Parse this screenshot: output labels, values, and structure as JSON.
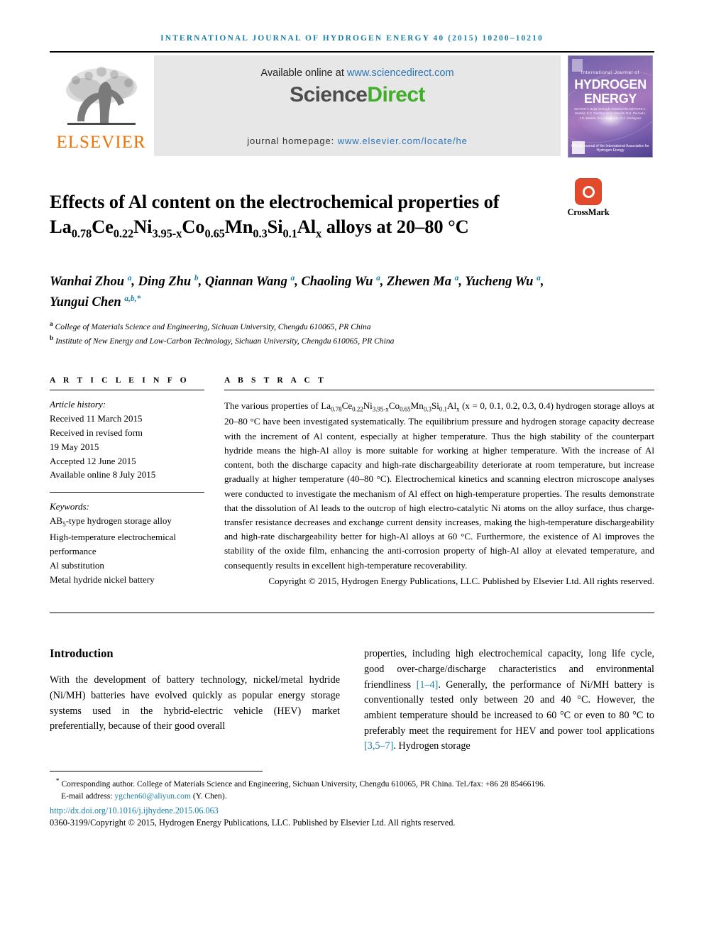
{
  "running_head": "INTERNATIONAL JOURNAL OF HYDROGEN ENERGY 40 (2015) 10200–10210",
  "masthead": {
    "publisher_logo_text": "ELSEVIER",
    "available_online_prefix": "Available online at ",
    "sciencedirect_url": "www.sciencedirect.com",
    "sciencedirect_logo_part1": "Science",
    "sciencedirect_logo_part2": "Direct",
    "journal_homepage_label": "journal homepage: ",
    "journal_homepage_url": "www.elsevier.com/locate/he",
    "cover": {
      "pre_title": "International Journal of",
      "line1": "HYDROGEN",
      "line2": "ENERGY",
      "editors": "EDITOR  T. Nejat Veziroglu\nASSOCIATE EDITORS  A. Bastida, E.C. Gardner, M.W. Moreda,\nB.D. Preciado, J.R. Bartlett, G.-L. Hu, F. Lee, C.C. Rodrigues",
      "footer": "Official Journal of the International Association for Hydrogen Energy"
    }
  },
  "article": {
    "title_segments": [
      {
        "t": "Effects of Al content on the electrochemical "
      },
      {
        "t": "properties of La"
      },
      {
        "sub": "0.78"
      },
      {
        "t": "Ce"
      },
      {
        "sub": "0.22"
      },
      {
        "t": "Ni"
      },
      {
        "sub": "3.95-x"
      },
      {
        "t": "Co"
      },
      {
        "sub": "0.65"
      },
      {
        "t": "Mn"
      },
      {
        "sub": "0.3"
      },
      {
        "t": "Si"
      },
      {
        "sub": "0.1"
      },
      {
        "t": "Al"
      },
      {
        "sub": "x"
      },
      {
        "t": " alloys at 20–80 °C"
      }
    ],
    "title_plain": "Effects of Al content on the electrochemical properties of La0.78Ce0.22Ni3.95-xCo0.65Mn0.3Si0.1Alx alloys at 20–80 °C",
    "crossmark_label": "CrossMark",
    "authors": "Wanhai Zhou a, Ding Zhu b, Qiannan Wang a, Chaoling Wu a, Zhewen Ma a, Yucheng Wu a, Yungui Chen a,b,*",
    "affiliations": [
      {
        "mark": "a",
        "text": "College of Materials Science and Engineering, Sichuan University, Chengdu 610065, PR China"
      },
      {
        "mark": "b",
        "text": "Institute of New Energy and Low-Carbon Technology, Sichuan University, Chengdu 610065, PR China"
      }
    ]
  },
  "article_info": {
    "heading": "A R T I C L E   I N F O",
    "history_label": "Article history:",
    "history": [
      "Received 11 March 2015",
      "Received in revised form",
      "19 May 2015",
      "Accepted 12 June 2015",
      "Available online 8 July 2015"
    ],
    "keywords_label": "Keywords:",
    "keywords": [
      "AB5-type hydrogen storage alloy",
      "High-temperature electrochemical performance",
      "Al substitution",
      "Metal hydride nickel battery"
    ]
  },
  "abstract": {
    "heading": "A B S T R A C T",
    "text": "The various properties of La0.78Ce0.22Ni3.95-xCo0.65Mn0.3Si0.1Alx (x = 0, 0.1, 0.2, 0.3, 0.4) hydrogen storage alloys at 20–80 °C have been investigated systematically. The equilibrium pressure and hydrogen storage capacity decrease with the increment of Al content, especially at higher temperature. Thus the high stability of the counterpart hydride means the high-Al alloy is more suitable for working at higher temperature. With the increase of Al content, both the discharge capacity and high-rate dischargeability deteriorate at room temperature, but increase gradually at higher temperature (40–80 °C). Electrochemical kinetics and scanning electron microscope analyses were conducted to investigate the mechanism of Al effect on high-temperature properties. The results demonstrate that the dissolution of Al leads to the outcrop of high electro-catalytic Ni atoms on the alloy surface, thus charge-transfer resistance decreases and exchange current density increases, making the high-temperature dischargeability and high-rate dischargeability better for high-Al alloys at 60 °C. Furthermore, the existence of Al improves the stability of the oxide film, enhancing the anti-corrosion property of high-Al alloy at elevated temperature, and consequently results in excellent high-temperature recoverability.",
    "copyright": "Copyright © 2015, Hydrogen Energy Publications, LLC. Published by Elsevier Ltd. All rights reserved."
  },
  "body": {
    "section_title": "Introduction",
    "left_paragraph": "With the development of battery technology, nickel/metal hydride (Ni/MH) batteries have evolved quickly as popular energy storage systems used in the hybrid-electric vehicle (HEV) market preferentially, because of their good overall",
    "right_paragraph_part1": "properties, including high electrochemical capacity, long life cycle, good over-charge/discharge characteristics and environmental friendliness ",
    "right_citation1": "[1–4]",
    "right_paragraph_part2": ". Generally, the performance of Ni/MH battery is conventionally tested only between 20 and 40 °C. However, the ambient temperature should be increased to 60 °C or even to 80 °C to preferably meet the requirement for HEV and power tool applications ",
    "right_citation2": "[3,5–7]",
    "right_paragraph_part3": ". Hydrogen storage"
  },
  "footer": {
    "corresponding_marker": "*",
    "corresponding_text": "Corresponding author. College of Materials Science and Engineering, Sichuan University, Chengdu 610065, PR China. Tel./fax: +86 28 85466196.",
    "email_label": "E-mail address: ",
    "email": "ygchen60@aliyun.com",
    "email_suffix": " (Y. Chen).",
    "doi_url": "http://dx.doi.org/10.1016/j.ijhydene.2015.06.063",
    "issn_copyright": "0360-3199/Copyright © 2015, Hydrogen Energy Publications, LLC. Published by Elsevier Ltd. All rights reserved."
  },
  "colors": {
    "link": "#1b7fa8",
    "elsevier_orange": "#ec7404",
    "sciencedirect_green": "#3fae29",
    "crossmark_red": "#e24a2b"
  }
}
